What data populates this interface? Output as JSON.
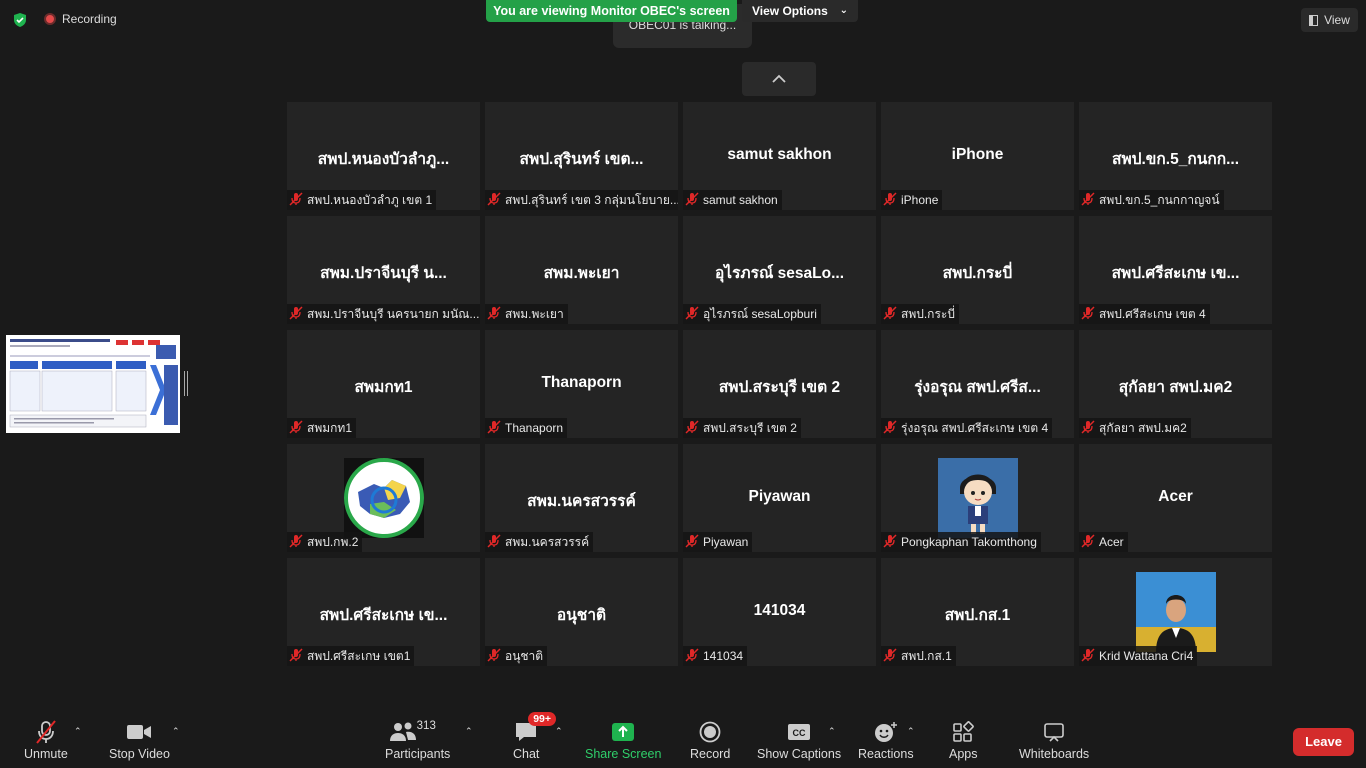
{
  "top_bar": {
    "recording_label": "Recording",
    "talking_text": "OBEC01 is talking...",
    "viewing_banner": "You are viewing Monitor OBEC's screen",
    "view_options_label": "View Options",
    "view_label": "View"
  },
  "tiles": [
    {
      "name": "สพป.หนองบัวลำภู...",
      "label": "สพป.หนองบัวลำภู เขต 1"
    },
    {
      "name": "สพป.สุรินทร์ เขต...",
      "label": "สพป.สุรินทร์ เขต 3 กลุ่มนโยบาย..."
    },
    {
      "name": "samut sakhon",
      "label": "samut sakhon"
    },
    {
      "name": "iPhone",
      "label": "iPhone"
    },
    {
      "name": "สพป.ขก.5_กนกก...",
      "label": "สพป.ขก.5_กนกกาญจน์"
    },
    {
      "name": "สพม.ปราจีนบุรี น...",
      "label": "สพม.ปราจีนบุรี นครนายก มนัณ..."
    },
    {
      "name": "สพม.พะเยา",
      "label": "สพม.พะเยา"
    },
    {
      "name": "อุไรภรณ์ sesaLo...",
      "label": "อุไรภรณ์ sesaLopburi"
    },
    {
      "name": "สพป.กระบี่",
      "label": "สพป.กระบี่"
    },
    {
      "name": "สพป.ศรีสะเกษ เข...",
      "label": "สพป.ศรีสะเกษ เขต 4"
    },
    {
      "name": "สพมกท1",
      "label": "สพมกท1"
    },
    {
      "name": "Thanaporn",
      "label": "Thanaporn"
    },
    {
      "name": "สพป.สระบุรี เขต 2",
      "label": "สพป.สระบุรี เขต 2"
    },
    {
      "name": "รุ่งอรุณ สพป.ศรีส...",
      "label": "รุ่งอรุณ สพป.ศรีสะเกษ เขต 4"
    },
    {
      "name": "สุกัลยา สพป.มค2",
      "label": "สุกัลยา สพป.มค2"
    },
    {
      "name": "",
      "label": "สพป.กพ.2",
      "image": "logo"
    },
    {
      "name": "สพม.นครสวรรค์",
      "label": "สพม.นครสวรรค์"
    },
    {
      "name": "Piyawan",
      "label": "Piyawan"
    },
    {
      "name": "",
      "label": "Pongkaphan Takomthong",
      "image": "cartoon"
    },
    {
      "name": "Acer",
      "label": "Acer"
    },
    {
      "name": "สพป.ศรีสะเกษ เข...",
      "label": "สพป.ศรีสะเกษ เขต1"
    },
    {
      "name": "อนุชาติ",
      "label": "อนุชาติ"
    },
    {
      "name": "141034",
      "label": "141034"
    },
    {
      "name": "สพป.กส.1",
      "label": "สพป.กส.1"
    },
    {
      "name": "",
      "label": "Krid Wattana Cri4",
      "image": "photo"
    }
  ],
  "toolbar": {
    "unmute": "Unmute",
    "stop_video": "Stop Video",
    "participants": "Participants",
    "participants_count": "313",
    "chat": "Chat",
    "chat_badge": "99+",
    "share_screen": "Share Screen",
    "record": "Record",
    "show_captions": "Show Captions",
    "reactions": "Reactions",
    "apps": "Apps",
    "whiteboards": "Whiteboards",
    "leave": "Leave"
  },
  "colors": {
    "green": "#24a148",
    "leave_red": "#d42c2c",
    "mute_red": "#e02828",
    "tile_bg": "#242424"
  }
}
